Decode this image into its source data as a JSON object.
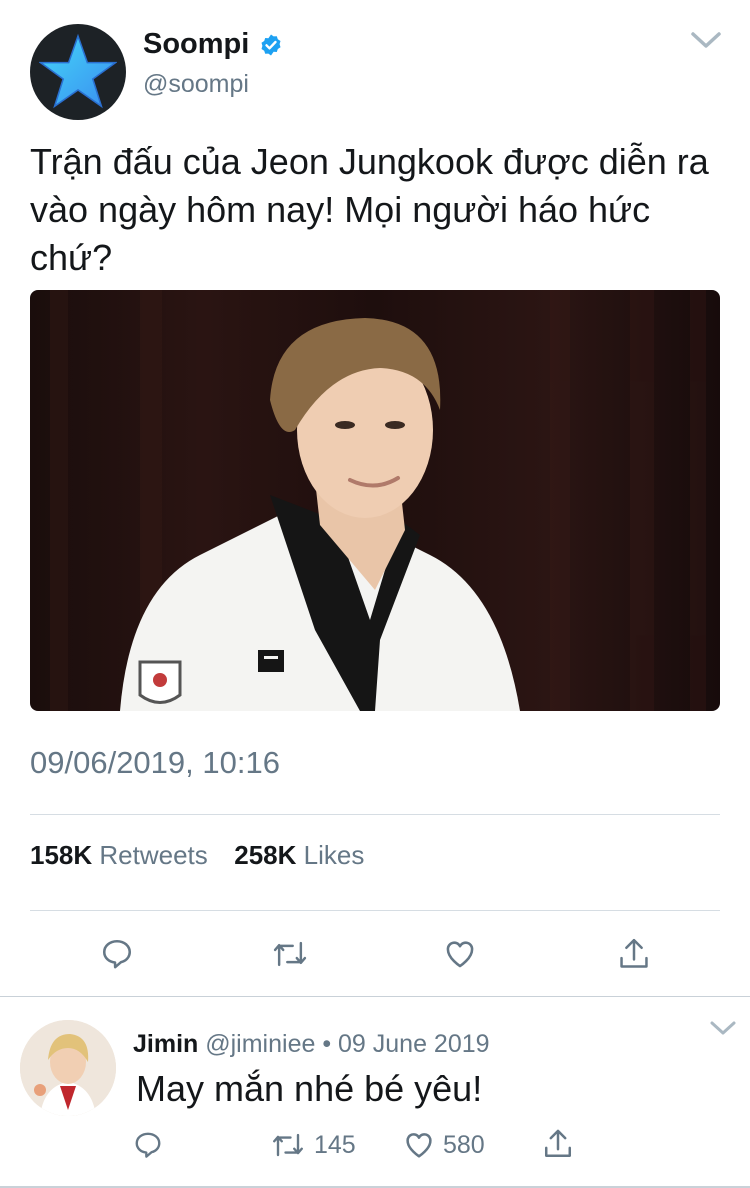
{
  "tweet": {
    "author_name": "Soompi",
    "author_handle": "@soompi",
    "text": "Trận đấu của Jeon Jungkook được diễn ra vào ngày hôm nay! Mọi người háo hức chứ?",
    "timestamp": "09/06/2019, 10:16",
    "retweets_count": "158K",
    "retweets_label": "Retweets",
    "likes_count": "258K",
    "likes_label": "Likes"
  },
  "reply": {
    "author_name": "Jimin",
    "meta": "@jiminiee • 09 June 2019",
    "text": "May mắn nhé bé yêu!",
    "retweet_count": "145",
    "like_count": "580"
  },
  "colors": {
    "accent": "#1da1f2",
    "text": "#14171a",
    "muted": "#657786",
    "star": "#33c6f5"
  },
  "icons": [
    "star-logo-icon",
    "verified-badge-icon",
    "chevron-down-icon",
    "reply-icon",
    "retweet-icon",
    "heart-icon",
    "share-icon"
  ]
}
